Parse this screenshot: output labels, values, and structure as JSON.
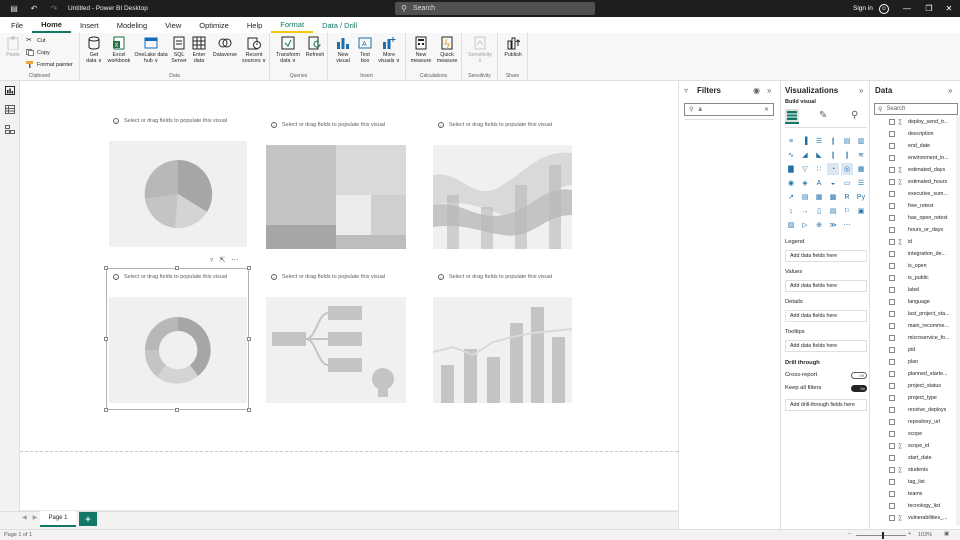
{
  "titlebar": {
    "app_title": "Untitled - Power BI Desktop",
    "search_placeholder": "Search",
    "signin": "Sign in"
  },
  "menu": {
    "tabs": [
      "File",
      "Home",
      "Insert",
      "Modeling",
      "View",
      "Optimize",
      "Help",
      "Format",
      "Data / Drill"
    ],
    "active": "Home"
  },
  "ribbon": {
    "clipboard": {
      "paste": "Paste",
      "cut": "Cut",
      "copy": "Copy",
      "format_painter": "Format painter",
      "label": "Clipboard"
    },
    "data": {
      "get_data": [
        "Get",
        "data ∨"
      ],
      "excel": [
        "Excel",
        "workbook"
      ],
      "onelake": [
        "OneLake data",
        "hub ∨"
      ],
      "sql": [
        "SQL",
        "Server"
      ],
      "enter": [
        "Enter",
        "data"
      ],
      "dataverse": [
        "Dataverse",
        ""
      ],
      "recent": [
        "Recent",
        "sources ∨"
      ],
      "label": "Data"
    },
    "queries": {
      "transform": [
        "Transform",
        "data ∨"
      ],
      "refresh": [
        "Refresh",
        ""
      ],
      "label": "Queries"
    },
    "insert": {
      "new_visual": [
        "New",
        "visual"
      ],
      "text_box": [
        "Text",
        "box"
      ],
      "more_visuals": [
        "More",
        "visuals ∨"
      ],
      "label": "Insert"
    },
    "calculations": {
      "new_measure": [
        "New",
        "measure"
      ],
      "quick_measure": [
        "Quick",
        "measure"
      ],
      "label": "Calculations"
    },
    "sensitivity": {
      "button": [
        "Sensitivity",
        "∨"
      ],
      "label": "Sensitivity"
    },
    "share": {
      "publish": [
        "Publish",
        ""
      ],
      "label": "Share"
    }
  },
  "canvas": {
    "hint": "Select or drag fields to populate this visual"
  },
  "pages": {
    "tab1": "Page 1",
    "add": "+"
  },
  "status": {
    "page_info": "Page 1 of 1",
    "zoom": "103%",
    "zoom_value": 103
  },
  "filters": {
    "title": "Filters",
    "search_value": "a"
  },
  "visualizations": {
    "title": "Visualizations",
    "build": "Build visual",
    "wells": {
      "legend": "Legend",
      "legend_box": "Add data fields here",
      "values": "Values",
      "values_box": "Add data fields here",
      "details": "Details",
      "details_box": "Add data fields here",
      "tooltips": "Tooltips",
      "tooltips_box": "Add data fields here"
    },
    "drill": {
      "title": "Drill through",
      "cross_report": "Cross-report",
      "cross_state": "Off",
      "keep_filters": "Keep all filters",
      "keep_state": "On",
      "drill_box": "Add drill-through fields here"
    }
  },
  "data_panel": {
    "title": "Data",
    "search_placeholder": "Search",
    "fields": [
      {
        "name": "deploy_send_tr...",
        "sigma": true
      },
      {
        "name": "description",
        "sigma": false
      },
      {
        "name": "end_date",
        "sigma": false
      },
      {
        "name": "environment_in...",
        "sigma": false
      },
      {
        "name": "estimated_days",
        "sigma": true
      },
      {
        "name": "estimated_hours",
        "sigma": true
      },
      {
        "name": "executive_sum...",
        "sigma": false
      },
      {
        "name": "free_retest",
        "sigma": false
      },
      {
        "name": "has_open_retest",
        "sigma": false
      },
      {
        "name": "hours_or_days",
        "sigma": false
      },
      {
        "name": "id",
        "sigma": true
      },
      {
        "name": "integration_de...",
        "sigma": false
      },
      {
        "name": "is_open",
        "sigma": false
      },
      {
        "name": "is_public",
        "sigma": false
      },
      {
        "name": "label",
        "sigma": false
      },
      {
        "name": "language",
        "sigma": false
      },
      {
        "name": "last_project_sta...",
        "sigma": false
      },
      {
        "name": "main_recomme...",
        "sigma": false
      },
      {
        "name": "microservice_fo...",
        "sigma": false
      },
      {
        "name": "pid",
        "sigma": false
      },
      {
        "name": "plan",
        "sigma": false
      },
      {
        "name": "planned_starte...",
        "sigma": false
      },
      {
        "name": "project_status",
        "sigma": false
      },
      {
        "name": "project_type",
        "sigma": false
      },
      {
        "name": "receive_deploys",
        "sigma": false
      },
      {
        "name": "repository_url",
        "sigma": false
      },
      {
        "name": "scope",
        "sigma": false
      },
      {
        "name": "scope_id",
        "sigma": true
      },
      {
        "name": "start_date",
        "sigma": false
      },
      {
        "name": "students",
        "sigma": true
      },
      {
        "name": "tag_list",
        "sigma": false
      },
      {
        "name": "teams",
        "sigma": false
      },
      {
        "name": "tecnology_list",
        "sigma": false
      },
      {
        "name": "vulnerabilities_...",
        "sigma": true
      }
    ]
  }
}
